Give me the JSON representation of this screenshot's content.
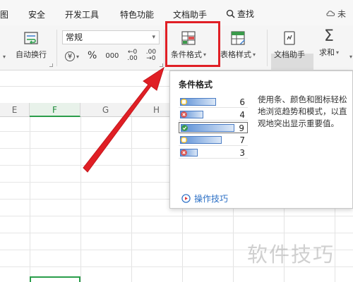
{
  "tabs": [
    {
      "label": "图"
    },
    {
      "label": "安全"
    },
    {
      "label": "开发工具"
    },
    {
      "label": "特色功能"
    },
    {
      "label": "文档助手"
    },
    {
      "label": "查找"
    },
    {
      "label": "未"
    }
  ],
  "ribbon": {
    "wrap_text": "自动换行",
    "number_format": "常规",
    "currency_symbol": "¥",
    "percent_symbol": "%",
    "thousands_symbol": "000",
    "decimal_increase_top": "←0",
    "decimal_increase_bottom": ".00",
    "decimal_decrease_top": ".00",
    "decimal_decrease_bottom": "→0",
    "conditional_format": "条件格式",
    "table_style": "表格样式",
    "doc_helper": "文档助手",
    "sum": "求和",
    "sum_symbol": "Σ"
  },
  "columns": [
    {
      "label": "E"
    },
    {
      "label": "F"
    },
    {
      "label": "G"
    },
    {
      "label": "H"
    }
  ],
  "tooltip": {
    "title": "条件格式",
    "description": "使用条、颜色和图标轻松地浏览趋势和模式，以直观地突出显示重要值。",
    "rows": [
      {
        "value": "6",
        "icon": "flag-icon"
      },
      {
        "value": "4",
        "icon": "x-circle-icon"
      },
      {
        "value": "9",
        "icon": "check-circle-icon"
      },
      {
        "value": "7",
        "icon": "flag-icon"
      },
      {
        "value": "3",
        "icon": "x-circle-icon"
      }
    ],
    "bar_fractions": [
      0.67,
      0.44,
      1.0,
      0.78,
      0.33
    ],
    "link": "操作技巧"
  },
  "watermark": "软件技巧",
  "colors": {
    "highlight": "#e01f25",
    "selection": "#2a9d4a",
    "link": "#2b6fc5"
  }
}
